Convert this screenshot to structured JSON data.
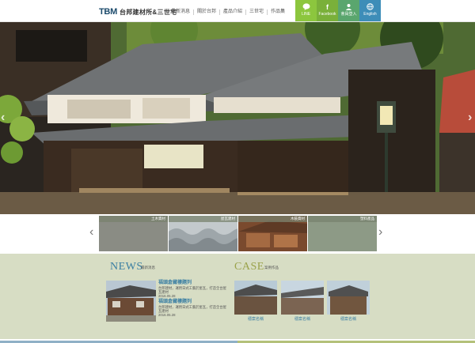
{
  "header": {
    "logo_mark": "TBM",
    "logo_text": "台邦建材所&三世宅",
    "nav": [
      "最新消息",
      "關於台邦",
      "產品介紹",
      "三世宅",
      "作品集"
    ],
    "quick_buttons": [
      {
        "label": "LINE",
        "icon": "line-icon",
        "color": "#8cc63e"
      },
      {
        "label": "Facebook",
        "icon": "facebook-icon",
        "color": "#7ab03a"
      },
      {
        "label": "會員登入",
        "icon": "user-icon",
        "color": "#5aa66e"
      },
      {
        "label": "English",
        "icon": "globe-icon",
        "color": "#3d8db8"
      }
    ]
  },
  "hero": {
    "prev_label": "‹",
    "next_label": "›"
  },
  "strip": {
    "prev_label": "‹",
    "next_label": "›",
    "thumbs": [
      {
        "caption": "土木資材"
      },
      {
        "caption": "屋瓦建材"
      },
      {
        "caption": "木裝資材"
      },
      {
        "caption": "塑料產品"
      }
    ]
  },
  "news": {
    "title": "NEWS",
    "subtitle": "最新消息",
    "items": [
      {
        "title": "福頭倉藏樓題列",
        "desc": "台邦建材，運用日式工藝於屋瓦，打造全台屋瓦建材",
        "date": "2016.05.28"
      },
      {
        "title": "福頭倉藏樓題列",
        "desc": "台邦建材，運用日式工藝於屋瓦，打造全台屋瓦建材",
        "date": "2016.05.28"
      }
    ]
  },
  "case": {
    "title": "CASE",
    "subtitle": "案例作品",
    "items": [
      {
        "caption": "穩案名稱"
      },
      {
        "caption": "穩案名稱"
      },
      {
        "caption": "穩案名稱"
      }
    ]
  },
  "colors": {
    "accent_blue": "#3b7fa3",
    "accent_olive": "#9aa24a",
    "band_bg": "#d7ddc4"
  }
}
